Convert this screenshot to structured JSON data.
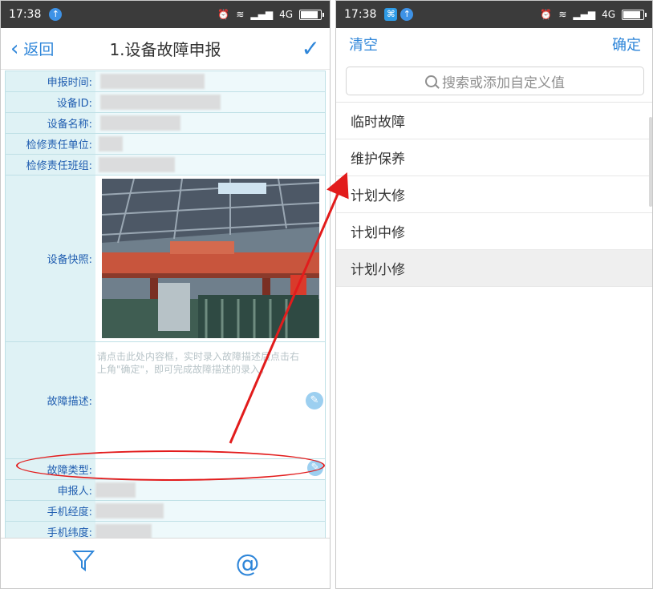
{
  "left_phone": {
    "status": {
      "time": "17:38",
      "network": "4G"
    },
    "header": {
      "back_label": "返回",
      "title": "1.设备故障申报"
    },
    "form": {
      "report_time_label": "申报时间:",
      "device_id_label": "设备ID:",
      "device_name_label": "设备名称:",
      "repair_unit_label": "检修责任单位:",
      "repair_team_label": "检修责任班组:",
      "photo_label": "设备快照:",
      "desc_label": "故障描述:",
      "desc_placeholder": "请点击此处内容框，实时录入故障描述后点击右上角\"确定\"，即可完成故障描述的录入。",
      "fault_type_label": "故障类型:",
      "reporter_label": "申报人:",
      "longitude_label": "手机经度:",
      "latitude_label": "手机纬度:"
    },
    "toolbar": {
      "filter_icon": "filter-icon",
      "at_icon": "at-icon"
    }
  },
  "right_phone": {
    "status": {
      "time": "17:38",
      "network": "4G"
    },
    "header": {
      "clear_label": "清空",
      "confirm_label": "确定"
    },
    "search": {
      "placeholder": "搜索或添加自定义值"
    },
    "options": [
      {
        "label": "临时故障"
      },
      {
        "label": "维护保养"
      },
      {
        "label": "计划大修"
      },
      {
        "label": "计划中修"
      },
      {
        "label": "计划小修",
        "selected": true
      }
    ]
  },
  "colors": {
    "accent": "#2f86d9",
    "annotation": "#e21c1c",
    "label_bg": "#dff2f5"
  }
}
